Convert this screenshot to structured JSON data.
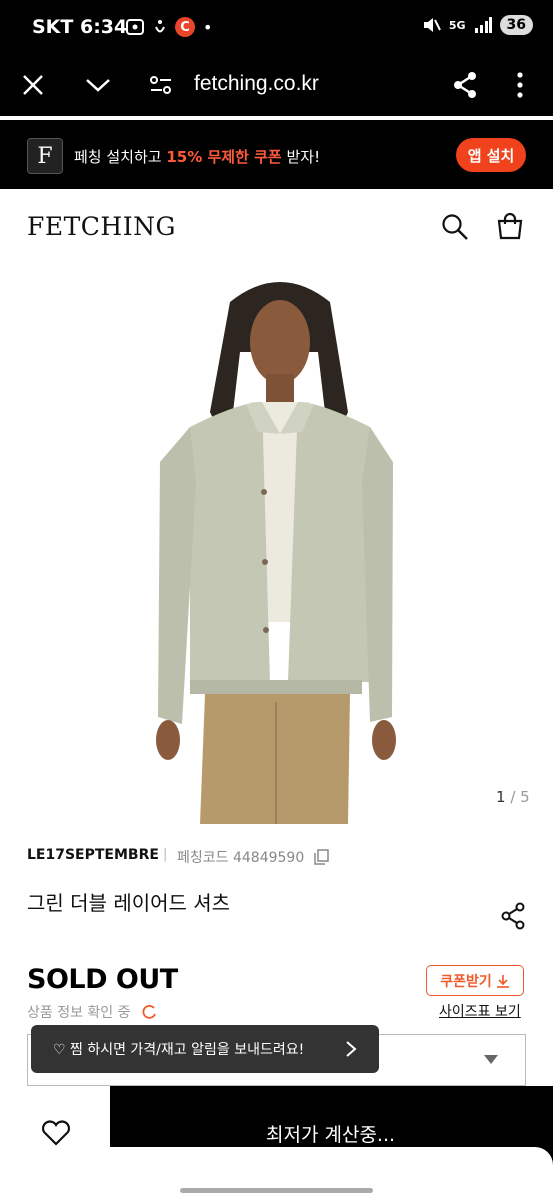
{
  "status_bar": {
    "carrier_time": "SKT 6:34",
    "battery": "36",
    "network": "5G"
  },
  "browser": {
    "url": "fetching.co.kr"
  },
  "banner": {
    "text_before": "페칭 설치하고 ",
    "text_highlight": "15% 무제한 쿠폰",
    "text_after": " 받자!",
    "install_label": "앱 설치",
    "logo_letter": "F"
  },
  "header": {
    "logo": "FETCHING"
  },
  "gallery": {
    "current": "1",
    "total": "/ 5"
  },
  "product": {
    "brand": "LE17SEPTEMBRE",
    "separator": "|",
    "code_label": "페칭코드 44849590",
    "title": "그린 더블 레이어드 셔츠",
    "status": "SOLD OUT",
    "checking": "상품 정보 확인 중",
    "coupon_label": "쿠폰받기",
    "size_chart_label": "사이즈표 보기"
  },
  "toast": {
    "text": "♡ 찜 하시면 가격/재고 알림을 보내드려요!"
  },
  "bottom": {
    "price_label": "최저가 계산중..."
  },
  "colors": {
    "accent": "#f0421d",
    "banner_bg": "#000000",
    "shirt": "#c4c7b3",
    "pants": "#b79a6c"
  }
}
